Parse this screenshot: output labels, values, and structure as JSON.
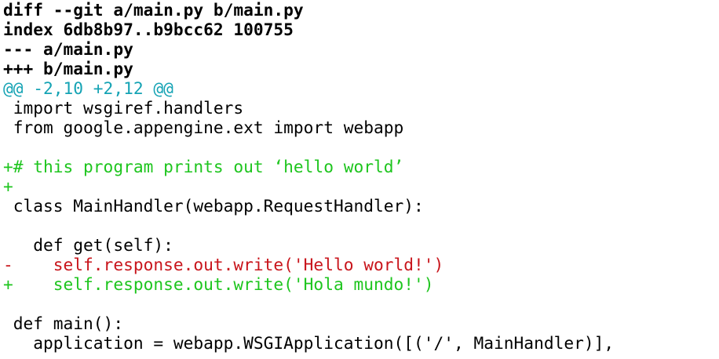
{
  "colors": {
    "header": "#000000",
    "hunk": "#15a3b4",
    "added": "#1ec51e",
    "removed": "#c8141b",
    "context": "#000000",
    "background": "#ffffff"
  },
  "diff": {
    "header_lines": [
      "diff --git a/main.py b/main.py",
      "index 6db8b97..b9bcc62 100755",
      "--- a/main.py",
      "+++ b/main.py"
    ],
    "hunk_header": "@@ -2,10 +2,12 @@",
    "body_lines": [
      " import wsgiref.handlers",
      " from google.appengine.ext import webapp",
      "",
      "+# this program prints out ‘hello world’",
      "+",
      " class MainHandler(webapp.RequestHandler):",
      "",
      "   def get(self):",
      "-    self.response.out.write('Hello world!')",
      "+    self.response.out.write('Hola mundo!')",
      "",
      " def main():",
      "   application = webapp.WSGIApplication([('/', MainHandler)],"
    ]
  }
}
